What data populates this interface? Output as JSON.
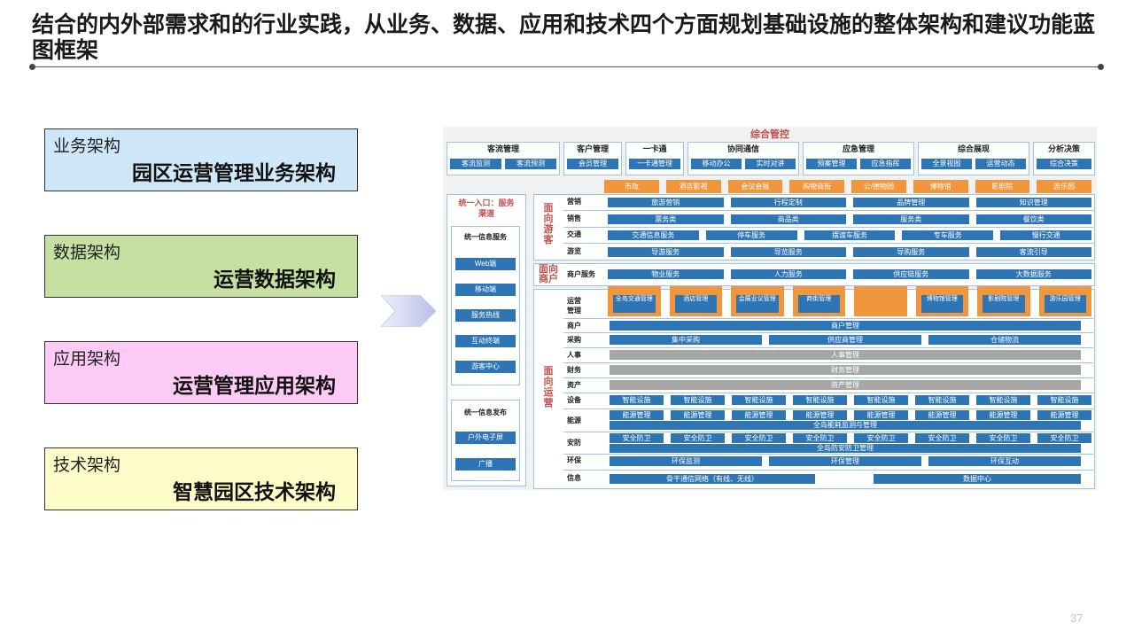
{
  "slide": {
    "title": "结合的内外部需求和的行业实践，从业务、数据、应用和技术四个方面规划基础设施的整体架构和建议功能蓝图框架",
    "page_number": "37",
    "accent_colors": {
      "business": "#cfe8f9",
      "data": "#c5e0a1",
      "application": "#fdcbf5",
      "technology": "#fefcc9"
    }
  },
  "cards": [
    {
      "label": "业务架构",
      "title": "园区运营管理业务架构",
      "color": "#cfe8f9"
    },
    {
      "label": "数据架构",
      "title": "运营数据架构",
      "color": "#c5e0a1"
    },
    {
      "label": "应用架构",
      "title": "运营管理应用架构",
      "color": "#fdcbf5"
    },
    {
      "label": "技术架构",
      "title": "智慧园区技术架构",
      "color": "#fefcc9"
    }
  ],
  "diagram": {
    "header": "综合管控",
    "top_groups": [
      {
        "name": "客流管理",
        "items": [
          "客流监测",
          "客流预测"
        ]
      },
      {
        "name": "客户管理",
        "items": [
          "会员管理"
        ]
      },
      {
        "name": "一卡通",
        "items": [
          "一卡通管理"
        ]
      },
      {
        "name": "协同通信",
        "items": [
          "移动办公",
          "实时对讲"
        ]
      },
      {
        "name": "应急管理",
        "items": [
          "预案管理",
          "应急指挥"
        ]
      },
      {
        "name": "综合展现",
        "items": [
          "全景视图",
          "运营动态"
        ]
      },
      {
        "name": "分析决策",
        "items": [
          "综合决策"
        ]
      }
    ],
    "venues": [
      "市政",
      "酒店影视",
      "会议会展",
      "购物商街",
      "公/德物园",
      "博物馆",
      "影剧院",
      "游乐园"
    ],
    "left": {
      "entry_title": "统一入口：服务渠道",
      "service_title": "统一信息服务",
      "service_items": [
        "Web端",
        "移动端",
        "服务热线",
        "互动终端",
        "游客中心"
      ],
      "publish_title": "统一信息发布",
      "publish_items": [
        "户外电子屏",
        "广播"
      ]
    },
    "sections": {
      "tourist": "面向游客",
      "merchant": "面向商户",
      "operation": "面向运营"
    },
    "tourist_rows": [
      {
        "label": "营销",
        "items": [
          "旅游营销",
          "行程定制",
          "品牌管理",
          "知识管理"
        ]
      },
      {
        "label": "销售",
        "items": [
          "票务类",
          "商品类",
          "服务类",
          "餐饮类"
        ]
      },
      {
        "label": "交通",
        "items": [
          "交通信息服务",
          "停车服务",
          "摆渡车服务",
          "专车服务",
          "慢行交通"
        ]
      },
      {
        "label": "游览",
        "items": [
          "导游服务",
          "导览服务",
          "导购服务",
          "客流引导"
        ]
      }
    ],
    "merchant_row": {
      "label": "商户服务",
      "items": [
        "物业服务",
        "人力服务",
        "供应链服务",
        "大数据服务"
      ]
    },
    "operation_rows": {
      "mgmt_label": "运营管理",
      "mgmt_boxes": [
        "全岛交通管理",
        "酒店管理",
        "会展业议管理",
        "商街管理",
        "",
        "博物馆管理",
        "影剧院管理",
        "游乐园管理"
      ],
      "merchant": {
        "label": "商户",
        "bar": "商户管理"
      },
      "purchase": {
        "label": "采购",
        "items": [
          "集中采购",
          "供应商管理",
          "仓储物流"
        ]
      },
      "hr": {
        "label": "人事",
        "bar": "人事管理"
      },
      "finance": {
        "label": "财务",
        "bar": "财务管理"
      },
      "asset": {
        "label": "资产",
        "bar": "资产管理"
      },
      "equipment": {
        "label": "设备",
        "item": "智能设施",
        "count": 8
      },
      "energy": {
        "label": "能源",
        "item": "能源管理",
        "count": 8,
        "bar": "全岛能耗监测与管理"
      },
      "security": {
        "label": "安防",
        "item": "安全防卫",
        "count": 8,
        "bar": "全岛防安防卫管理"
      },
      "env": {
        "label": "环保",
        "items": [
          "环保监测",
          "环保管理",
          "环保互动"
        ]
      },
      "info": {
        "label": "信息",
        "items": [
          "骨干通信网络（有线、无线）",
          "数据中心"
        ]
      }
    }
  }
}
